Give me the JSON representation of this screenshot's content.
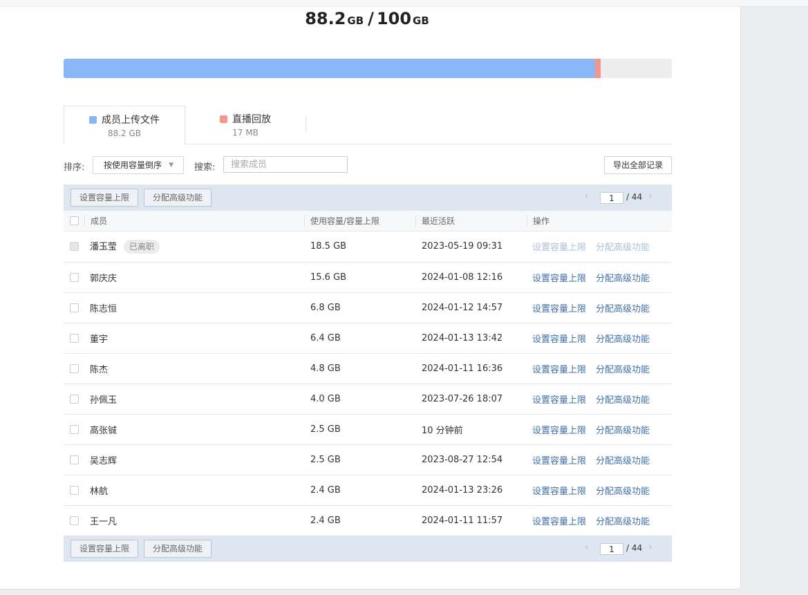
{
  "summary": {
    "used_value": "88.2",
    "used_unit": "GB",
    "separator": "/",
    "total_value": "100",
    "total_unit": "GB"
  },
  "usage_bar": {
    "segments": [
      {
        "name": "成员上传文件",
        "fraction": 0.8734,
        "color": "#88b6f6"
      },
      {
        "name": "直播回放",
        "fraction": 0.0086,
        "color": "#f3958b"
      }
    ],
    "track_color": "#ededed"
  },
  "categories": [
    {
      "label": "成员上传文件",
      "size": "88.2 GB",
      "color": "#88b6f6"
    },
    {
      "label": "直播回放",
      "size": "17 MB",
      "color": "#f3958b"
    }
  ],
  "filters": {
    "sort_label": "排序:",
    "sort_value": "按使用容量倒序",
    "search_label": "搜索:",
    "search_placeholder": "搜索成员",
    "export_label": "导出全部记录"
  },
  "toolbar": {
    "set_limit_label": "设置容量上限",
    "assign_label": "分配高级功能",
    "page_current": "1",
    "page_total": "/ 44"
  },
  "table": {
    "headers": {
      "member": "成员",
      "usage": "使用容量/容量上限",
      "last_active": "最近活跃",
      "actions": "操作"
    },
    "action_set_limit": "设置容量上限",
    "action_assign": "分配高级功能",
    "rows": [
      {
        "name": "潘玉莹",
        "badge": "已离职",
        "usage": "18.5 GB",
        "last_active": "2023-05-19 09:31"
      },
      {
        "name": "郭庆庆",
        "usage": "15.6 GB",
        "last_active": "2024-01-08 12:16"
      },
      {
        "name": "陈志恒",
        "usage": "6.8 GB",
        "last_active": "2024-01-12 14:57"
      },
      {
        "name": "董宇",
        "usage": "6.4 GB",
        "last_active": "2024-01-13 13:42"
      },
      {
        "name": "陈杰",
        "usage": "4.8 GB",
        "last_active": "2024-01-11 16:36"
      },
      {
        "name": "孙佩玉",
        "usage": "4.0 GB",
        "last_active": "2023-07-26 18:07"
      },
      {
        "name": "高张铖",
        "usage": "2.5 GB",
        "last_active": "10 分钟前"
      },
      {
        "name": "吴志辉",
        "usage": "2.5 GB",
        "last_active": "2023-08-27 12:54"
      },
      {
        "name": "林航",
        "usage": "2.4 GB",
        "last_active": "2024-01-13 23:26"
      },
      {
        "name": "王一凡",
        "usage": "2.4 GB",
        "last_active": "2024-01-11 11:57"
      }
    ]
  }
}
